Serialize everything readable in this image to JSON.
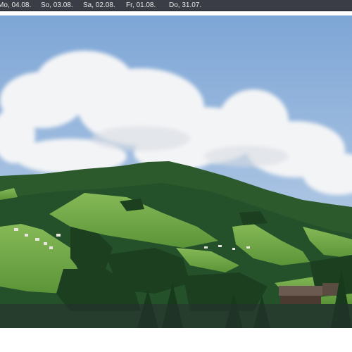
{
  "date_nav": {
    "items": [
      {
        "label": "Mo, 04.08."
      },
      {
        "label": "So, 03.08."
      },
      {
        "label": "Sa, 02.08."
      },
      {
        "label": "Fr, 01.08."
      },
      {
        "label": "Do, 31.07."
      }
    ]
  },
  "colors": {
    "nav_bg": "#3a3d45",
    "sky": "#8fb3d9",
    "cloud": "#f4f5f7",
    "meadow": "#6faa45",
    "forest": "#1f4524"
  }
}
